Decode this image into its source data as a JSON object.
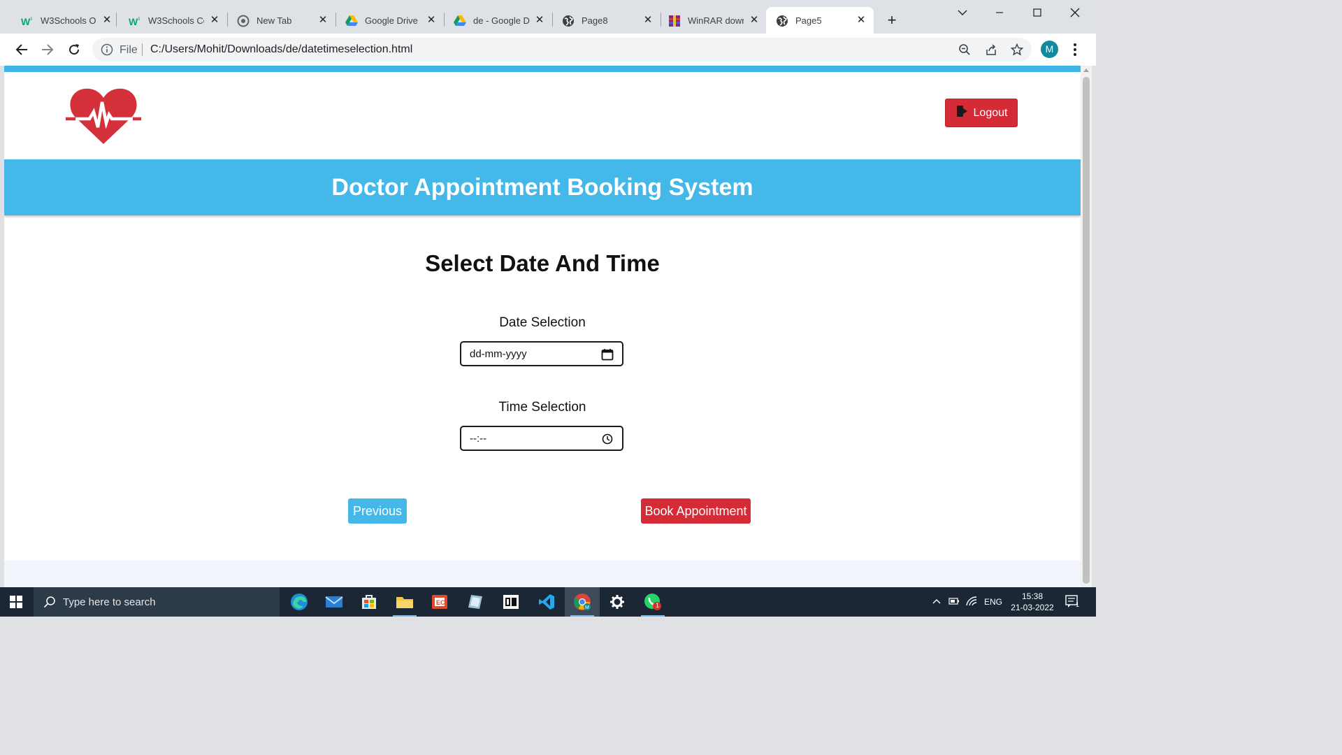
{
  "browser": {
    "tabs": [
      {
        "title": "W3Schools Or",
        "favicon": "w3schools-icon"
      },
      {
        "title": "W3Schools Cc",
        "favicon": "w3schools-icon"
      },
      {
        "title": "New Tab",
        "favicon": "chrome-icon"
      },
      {
        "title": "Google Drive",
        "favicon": "google-drive-icon"
      },
      {
        "title": "de - Google D",
        "favicon": "google-drive-icon"
      },
      {
        "title": "Page8",
        "favicon": "globe-icon"
      },
      {
        "title": "WinRAR dowr",
        "favicon": "winrar-icon"
      },
      {
        "title": "Page5",
        "favicon": "globe-icon",
        "active": true
      }
    ],
    "address": {
      "scheme_label": "File",
      "url": "C:/Users/Mohit/Downloads/de/datetimeselection.html"
    },
    "profile_initial": "M"
  },
  "page": {
    "logout_label": "Logout",
    "banner_title": "Doctor Appointment Booking System",
    "heading": "Select Date And Time",
    "date": {
      "label": "Date Selection",
      "placeholder": "dd-mm-yyyy"
    },
    "time": {
      "label": "Time Selection",
      "placeholder": "--:--"
    },
    "previous_label": "Previous",
    "book_label": "Book Appointment"
  },
  "taskbar": {
    "search_placeholder": "Type here to search",
    "language": "ENG",
    "time": "15:38",
    "date": "21-03-2022",
    "notification_count": "1",
    "whatsapp_badge": "1"
  },
  "colors": {
    "accent_blue": "#45b8ea",
    "accent_red": "#d52b36"
  }
}
